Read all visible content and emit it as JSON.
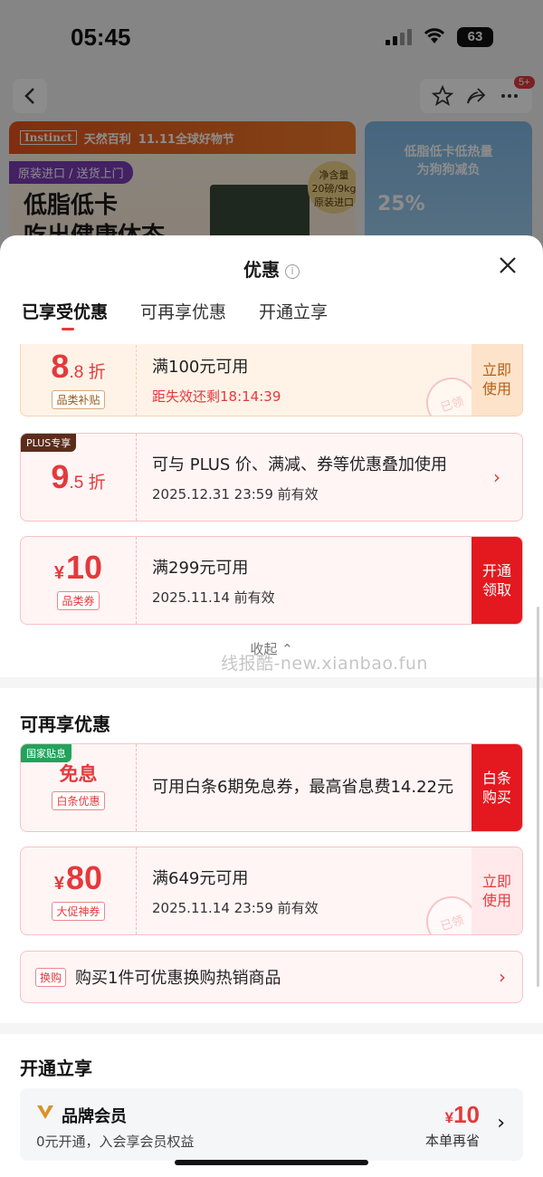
{
  "status_bar": {
    "time": "05:45",
    "battery": "63"
  },
  "nav": {
    "badge": "5+"
  },
  "banner": {
    "brand": "Instinct",
    "brand_cn": "天然百利",
    "festival": "11.11全球好物节",
    "tag": "原装进口 / 送货上门",
    "slogan_line1": "低脂低卡",
    "slogan_line2": "吃出健康体态",
    "net_label": "净含量",
    "net_value": "20磅/9kg",
    "net_sub": "原装进口",
    "side_line1": "低脂低卡低热量",
    "side_line2": "为狗狗减负",
    "side_pct": "25%"
  },
  "sheet": {
    "title": "优惠",
    "tabs": [
      "已享受优惠",
      "可再享优惠",
      "开通立享"
    ]
  },
  "enjoyed": [
    {
      "big": "8",
      "small": ".8 折",
      "sub": "品类补贴",
      "condition": "满100元可用",
      "countdown": "距失效还剩18:14:39",
      "action": "立即\n使用",
      "stamp": "已领"
    },
    {
      "tag": "PLUS专享",
      "big": "9",
      "small": ".5 折",
      "condition": "可与 PLUS 价、满减、券等优惠叠加使用",
      "valid": "2025.12.31 23:59 前有效",
      "action": "›"
    },
    {
      "cny": "¥",
      "big": "10",
      "sub": "品类券",
      "condition": "满299元可用",
      "valid": "2025.11.14 前有效",
      "action": "开通\n领取"
    }
  ],
  "collapse": "收起 ⌃",
  "more_title": "可再享优惠",
  "more": [
    {
      "tag": "国家贴息",
      "big": "免息",
      "sub": "白条优惠",
      "condition": "可用白条6期免息券，最高省息费14.22元",
      "action": "白条\n购买"
    },
    {
      "cny": "¥",
      "big": "80",
      "sub": "大促神券",
      "condition": "满649元可用",
      "valid": "2025.11.14 23:59 前有效",
      "action": "立即\n使用",
      "stamp": "已领"
    }
  ],
  "swap": {
    "tag": "换购",
    "text": "购买1件可优惠换购热销商品",
    "chevron": "›"
  },
  "open_title": "开通立享",
  "member": {
    "name": "品牌会员",
    "desc": "0元开通，入会享会员权益",
    "cny": "¥",
    "amount": "10",
    "label": "本单再省",
    "chevron": "›"
  },
  "watermark": "线报酷-new.xianbao.fun",
  "colors": {
    "accent": "#e4393c",
    "action_red": "#e4181f",
    "plus_brown": "#5a2d1b",
    "nation_green": "#21a35b"
  }
}
